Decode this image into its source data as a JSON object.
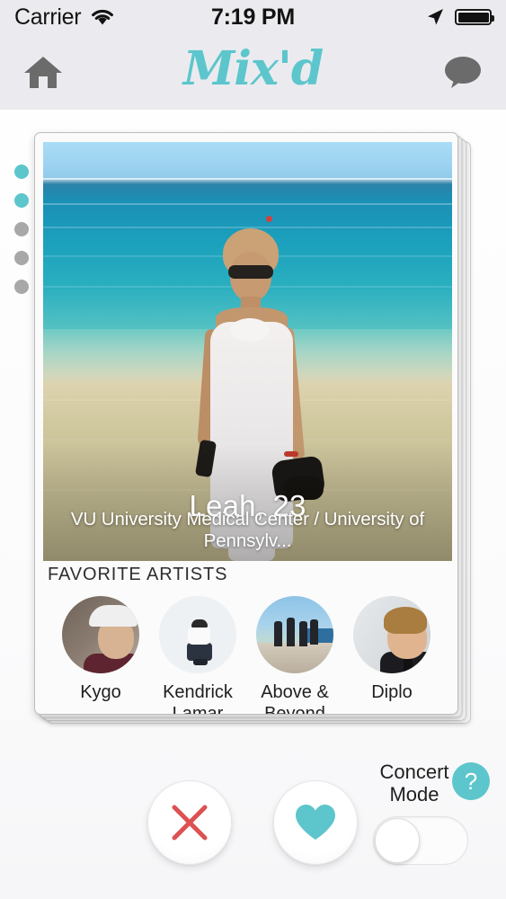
{
  "status_bar": {
    "carrier": "Carrier",
    "wifi_icon": "wifi-icon",
    "time": "7:19 PM",
    "location_icon": "location-arrow-icon",
    "battery_icon": "battery-full-icon",
    "battery_level_pct": 100
  },
  "header": {
    "home_icon": "home-icon",
    "logo_text": "Mix'd",
    "messages_icon": "chat-bubble-icon",
    "accent_color": "#5cc6cc",
    "background_color": "#ebebef"
  },
  "photo_pager": {
    "total": 5,
    "active_index": 1,
    "dots": [
      {
        "state": "active"
      },
      {
        "state": "active"
      },
      {
        "state": "inactive"
      },
      {
        "state": "inactive"
      },
      {
        "state": "inactive"
      }
    ],
    "active_color": "#5cc6cc",
    "inactive_color": "#a8a8a8"
  },
  "card_stack": {
    "behind_count": 3
  },
  "profile": {
    "name_age": "Leah, 23",
    "affiliation": "VU University Medical Center / University of Pennsylv...",
    "photo_alt": "woman-on-beach-photo"
  },
  "favorite_artists": {
    "section_label": "FAVORITE ARTISTS",
    "items": [
      {
        "name": "Kygo"
      },
      {
        "name": "Kendrick Lamar"
      },
      {
        "name": "Above & Beyond"
      },
      {
        "name": "Diplo"
      }
    ]
  },
  "actions": {
    "nope_icon": "close-x-icon",
    "nope_color": "#dd5151",
    "like_icon": "heart-icon",
    "like_color": "#5cc6cc"
  },
  "concert_mode": {
    "label_line1": "Concert",
    "label_line2": "Mode",
    "help_badge": "?",
    "help_badge_color": "#5cc6cc",
    "toggle_state": "off"
  }
}
